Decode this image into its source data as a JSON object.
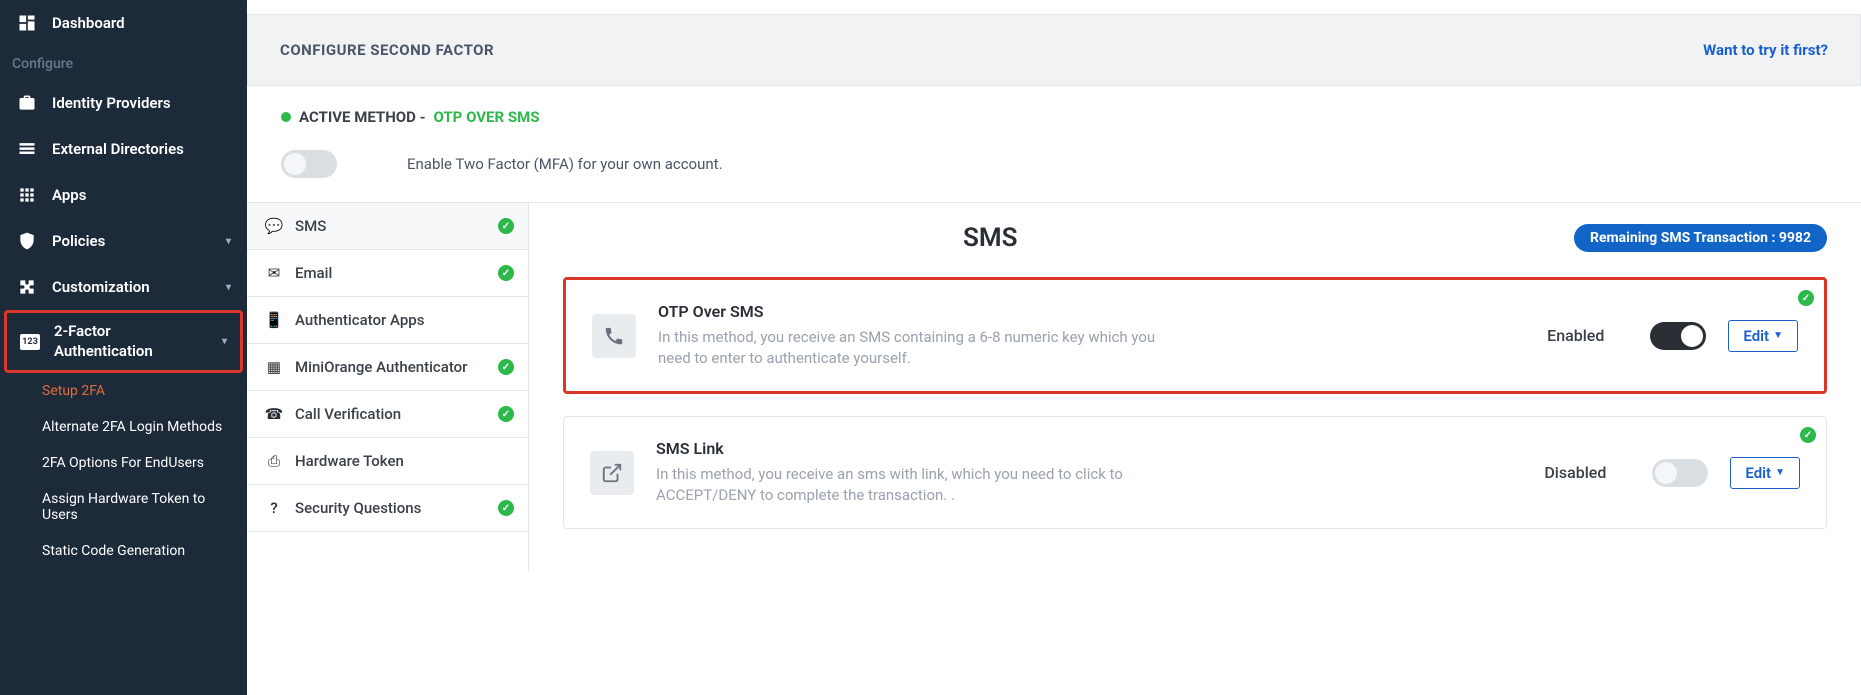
{
  "sidebar": {
    "dashboard": "Dashboard",
    "configure_label": "Configure",
    "identity_providers": "Identity Providers",
    "external_directories": "External Directories",
    "apps": "Apps",
    "policies": "Policies",
    "customization": "Customization",
    "twofa": "2-Factor Authentication",
    "subs": {
      "setup": "Setup 2FA",
      "alternate": "Alternate 2FA Login Methods",
      "endusers": "2FA Options For EndUsers",
      "assign_token": "Assign Hardware Token to Users",
      "static_code": "Static Code Generation"
    }
  },
  "header": {
    "title": "CONFIGURE SECOND FACTOR",
    "try_link": "Want to try it first?"
  },
  "active_method": {
    "prefix": "ACTIVE METHOD - ",
    "value": "OTP OVER SMS"
  },
  "enable_toggle_desc": "Enable Two Factor (MFA) for your own account.",
  "tabs": [
    {
      "label": "SMS",
      "checked": true
    },
    {
      "label": "Email",
      "checked": true
    },
    {
      "label": "Authenticator Apps",
      "checked": false
    },
    {
      "label": "MiniOrange Authenticator",
      "checked": true
    },
    {
      "label": "Call Verification",
      "checked": true
    },
    {
      "label": "Hardware Token",
      "checked": false
    },
    {
      "label": "Security Questions",
      "checked": true
    }
  ],
  "detail": {
    "title": "SMS",
    "remaining_label": "Remaining SMS Transaction : 9982"
  },
  "methods": [
    {
      "name": "OTP Over SMS",
      "desc": "In this method, you receive an SMS containing a 6-8 numeric key which you need to enter to authenticate yourself.",
      "status": "Enabled",
      "enabled": true,
      "edit": "Edit"
    },
    {
      "name": "SMS Link",
      "desc": "In this method, you receive an sms with link, which you need to click to ACCEPT/DENY to complete the transaction. .",
      "status": "Disabled",
      "enabled": false,
      "edit": "Edit"
    }
  ]
}
